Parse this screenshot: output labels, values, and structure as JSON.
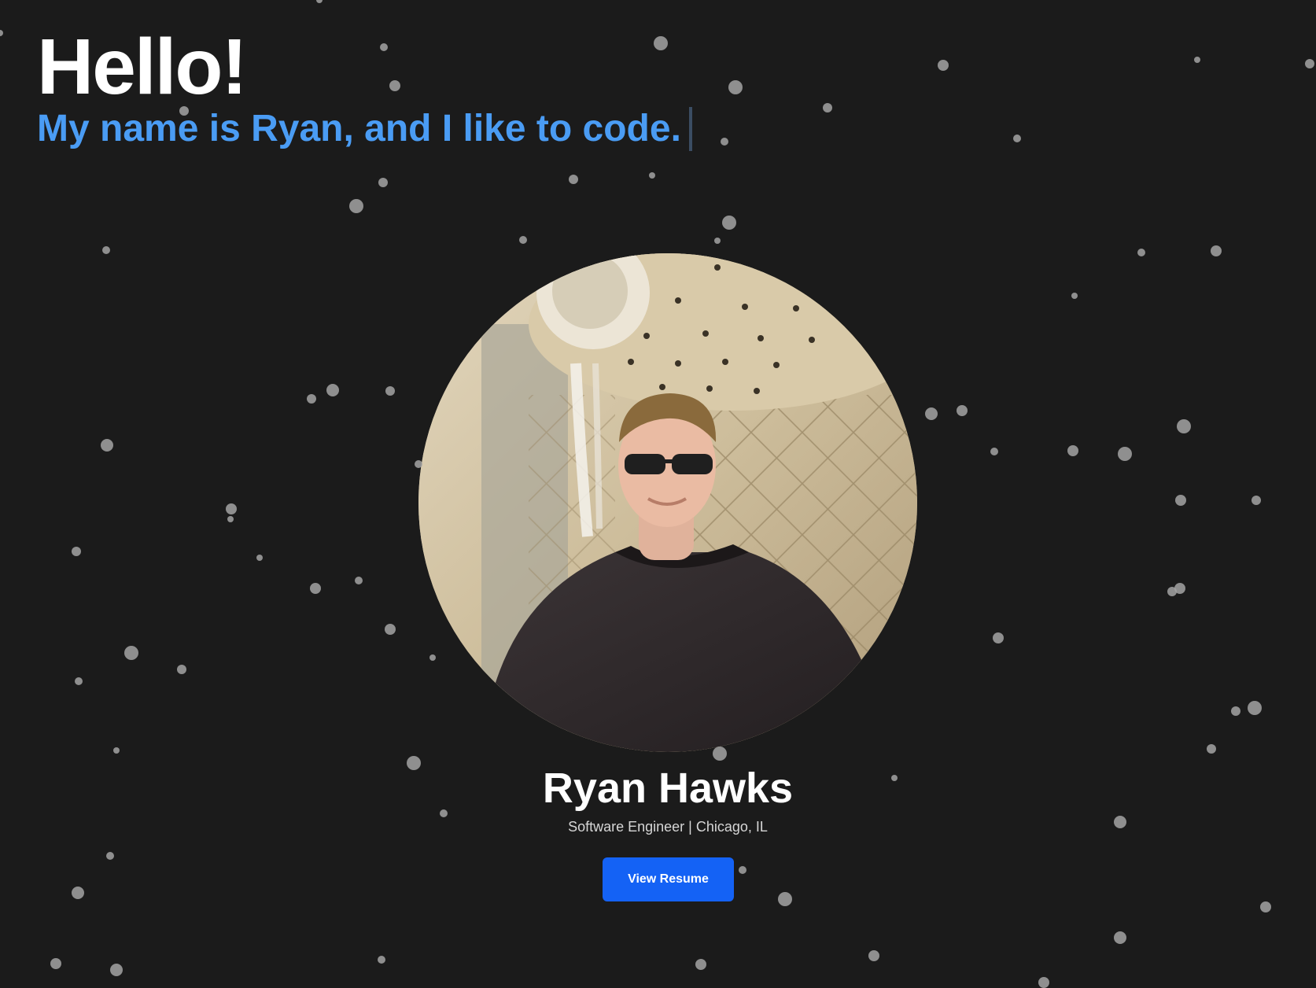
{
  "hero": {
    "greeting": "Hello!",
    "tagline": "My name is Ryan, and I like to code."
  },
  "profile": {
    "name": "Ryan Hawks",
    "subtitle": "Software Engineer | Chicago, IL",
    "resume_button_label": "View Resume"
  },
  "colors": {
    "background": "#1b1b1b",
    "accent": "#4a9cf4",
    "button": "#1462f5",
    "particles": "#a3a3a3"
  },
  "icons": [
    "text-cursor-icon",
    "portrait-photo"
  ]
}
